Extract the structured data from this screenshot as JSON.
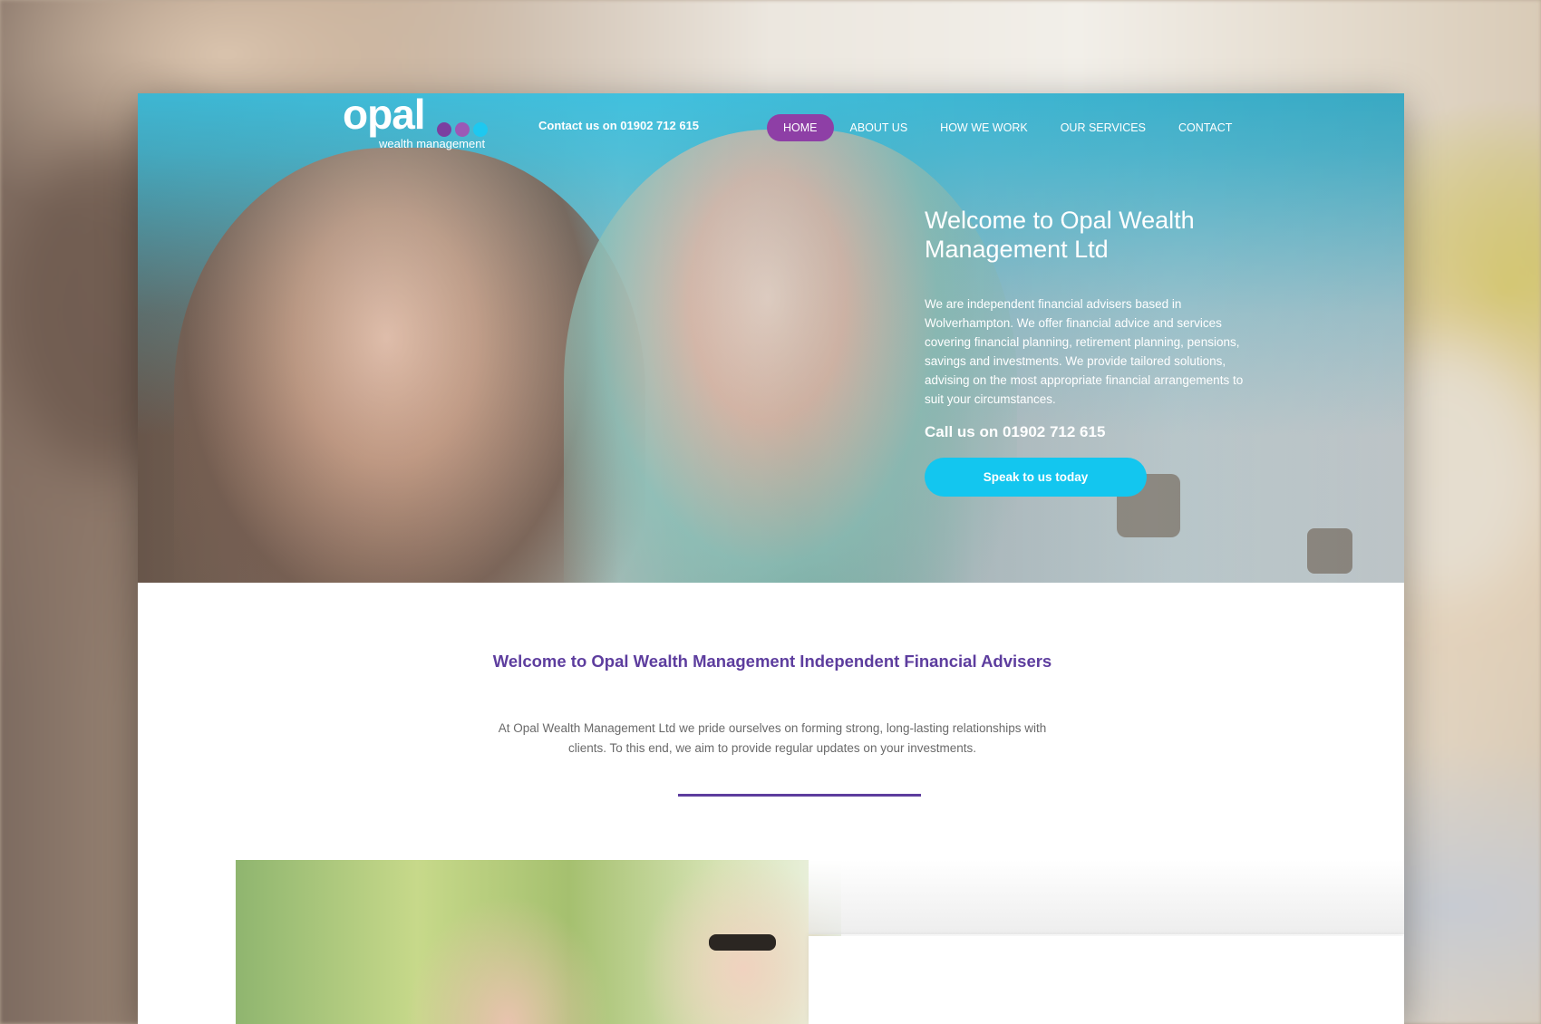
{
  "header": {
    "logo": {
      "word": "opal",
      "sub": "wealth management"
    },
    "contact": "Contact us on 01902 712 615",
    "nav": [
      {
        "label": "HOME",
        "active": true
      },
      {
        "label": "ABOUT US",
        "active": false
      },
      {
        "label": "HOW WE WORK",
        "active": false
      },
      {
        "label": "OUR SERVICES",
        "active": false
      },
      {
        "label": "CONTACT",
        "active": false
      }
    ]
  },
  "hero": {
    "title": "Welcome to Opal Wealth Management Ltd",
    "text": "We are independent financial advisers based in Wolverhampton. We offer financial advice and services covering financial planning, retirement planning, pensions, savings and investments.  We provide tailored solutions, advising on the most appropriate financial arrangements to suit your circumstances.",
    "call": "Call us on 01902 712 615",
    "cta": "Speak to us today"
  },
  "intro": {
    "title": "Welcome to Opal Wealth Management Independent Financial Advisers",
    "text": "At Opal Wealth Management Ltd we pride ourselves on forming strong, long-lasting relationships with clients. To this end, we aim to provide regular updates on your investments."
  },
  "colors": {
    "brand_blue": "#40c0de",
    "brand_purple": "#5d3d9e",
    "nav_active": "#8e3fa6",
    "cta": "#13c6ef"
  }
}
